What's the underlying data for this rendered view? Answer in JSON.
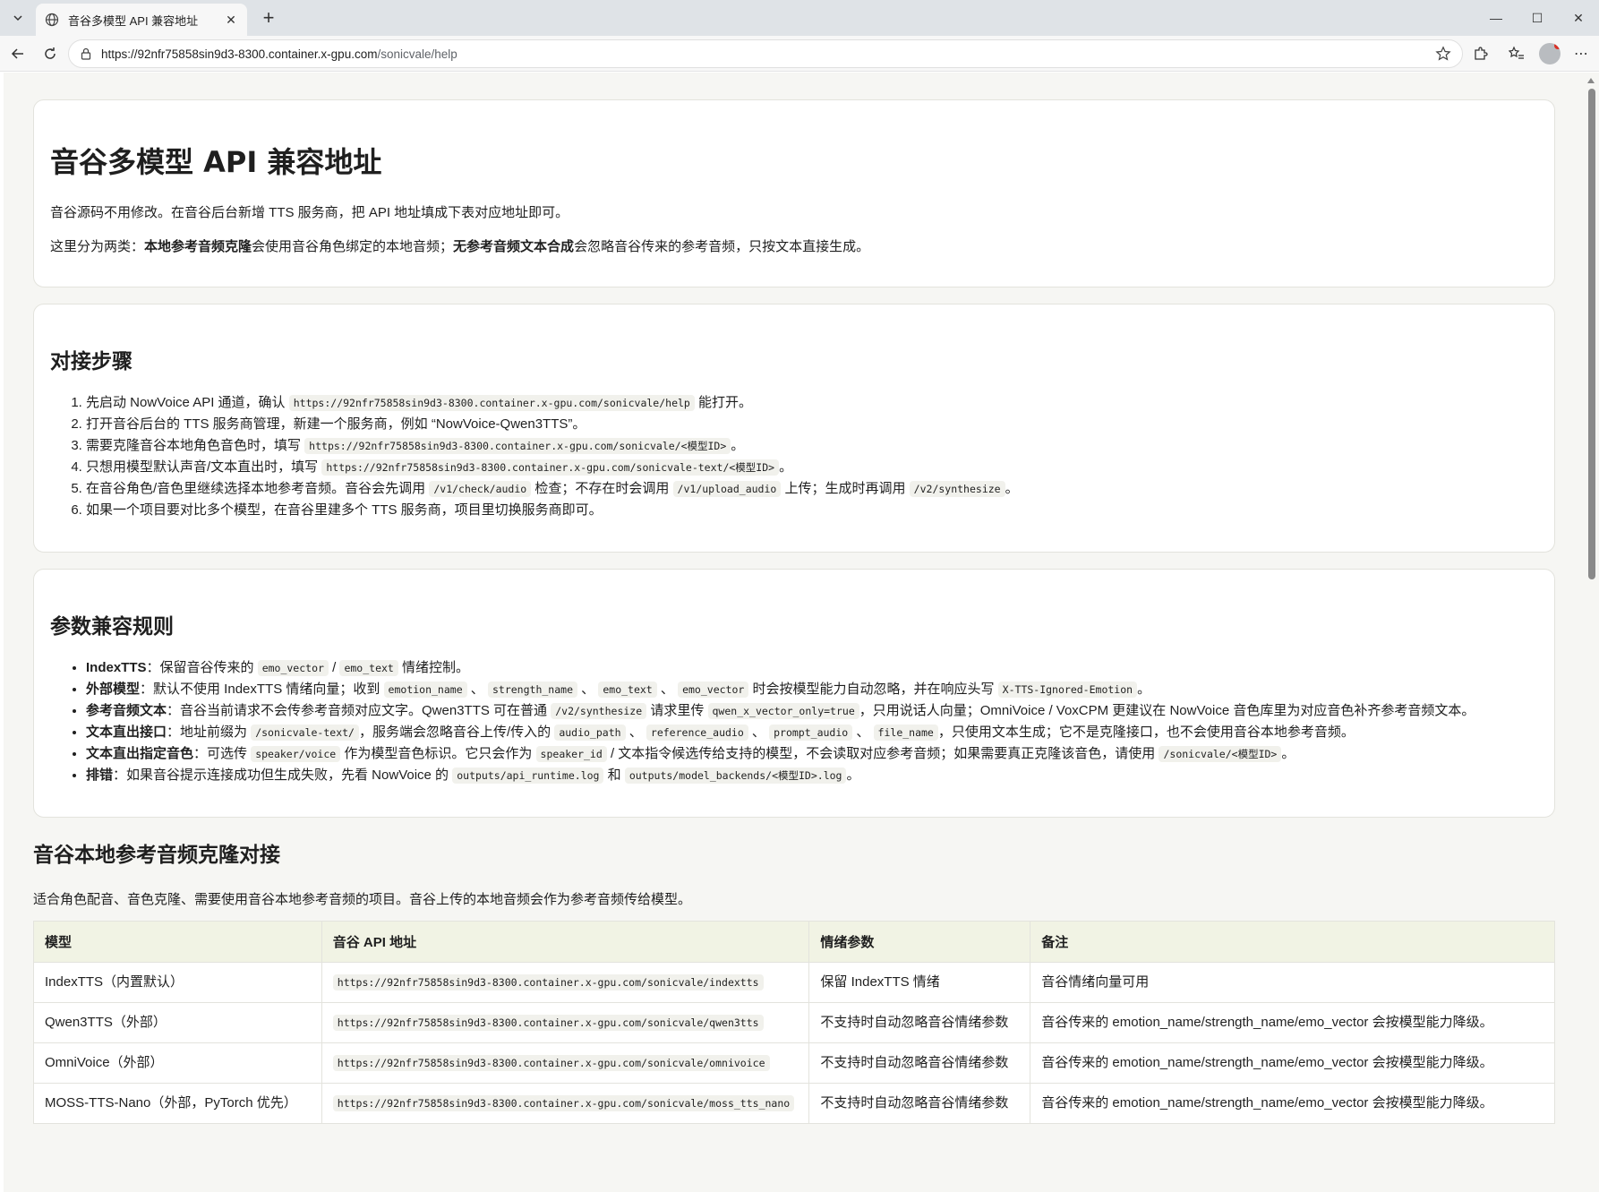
{
  "browser": {
    "tab_title": "音谷多模型 API 兼容地址",
    "url_host": "https://92nfr75858sin9d3-8300.container.x-gpu.com",
    "url_path": "/sonicvale/help"
  },
  "header": {
    "title": "音谷多模型 API 兼容地址",
    "intro": "音谷源码不用修改。在音谷后台新增 TTS 服务商，把 API 地址填成下表对应地址即可。",
    "split_prefix": "这里分为两类：",
    "split_bold1": "本地参考音频克隆",
    "split_mid": "会使用音谷角色绑定的本地音频；",
    "split_bold2": "无参考音频文本合成",
    "split_suffix": "会忽略音谷传来的参考音频，只按文本直接生成。"
  },
  "steps": {
    "title": "对接步骤",
    "s1_a": "先启动 NowVoice API 通道，确认 ",
    "s1_code": "https://92nfr75858sin9d3-8300.container.x-gpu.com/sonicvale/help",
    "s1_b": " 能打开。",
    "s2": "打开音谷后台的 TTS 服务商管理，新建一个服务商，例如 “NowVoice-Qwen3TTS”。",
    "s3_a": "需要克隆音谷本地角色音色时，填写 ",
    "s3_code": "https://92nfr75858sin9d3-8300.container.x-gpu.com/sonicvale/<模型ID>",
    "s3_b": "。",
    "s4_a": "只想用模型默认声音/文本直出时，填写 ",
    "s4_code": "https://92nfr75858sin9d3-8300.container.x-gpu.com/sonicvale-text/<模型ID>",
    "s4_b": "。",
    "s5_a": "在音谷角色/音色里继续选择本地参考音频。音谷会先调用 ",
    "s5_code1": "/v1/check/audio",
    "s5_b": " 检查；不存在时会调用 ",
    "s5_code2": "/v1/upload_audio",
    "s5_c": " 上传；生成时再调用 ",
    "s5_code3": "/v2/synthesize",
    "s5_d": "。",
    "s6": "如果一个项目要对比多个模型，在音谷里建多个 TTS 服务商，项目里切换服务商即可。"
  },
  "rules": {
    "title": "参数兼容规则",
    "r1_label": "IndexTTS",
    "r1_a": "：保留音谷传来的 ",
    "r1_code1": "emo_vector",
    "r1_b": " / ",
    "r1_code2": "emo_text",
    "r1_c": " 情绪控制。",
    "r2_label": "外部模型",
    "r2_a": "：默认不使用 IndexTTS 情绪向量；收到 ",
    "r2_code1": "emotion_name",
    "r2_sep1": " 、 ",
    "r2_code2": "strength_name",
    "r2_sep2": " 、 ",
    "r2_code3": "emo_text",
    "r2_sep3": " 、 ",
    "r2_code4": "emo_vector",
    "r2_b": " 时会按模型能力自动忽略，并在响应头写 ",
    "r2_code5": "X-TTS-Ignored-Emotion",
    "r2_c": "。",
    "r3_label": "参考音频文本",
    "r3_a": "：音谷当前请求不会传参考音频对应文字。Qwen3TTS 可在普通 ",
    "r3_code1": "/v2/synthesize",
    "r3_b": " 请求里传 ",
    "r3_code2": "qwen_x_vector_only=true",
    "r3_c": "，只用说话人向量；OmniVoice / VoxCPM 更建议在 NowVoice 音色库里为对应音色补齐参考音频文本。",
    "r4_label": "文本直出接口",
    "r4_a": "：地址前缀为 ",
    "r4_code1": "/sonicvale-text/",
    "r4_b": "，服务端会忽略音谷上传/传入的 ",
    "r4_code2": "audio_path",
    "r4_sep1": " 、 ",
    "r4_code3": "reference_audio",
    "r4_sep2": " 、 ",
    "r4_code4": "prompt_audio",
    "r4_sep3": " 、 ",
    "r4_code5": "file_name",
    "r4_c": "，只使用文本生成；它不是克隆接口，也不会使用音谷本地参考音频。",
    "r5_label": "文本直出指定音色",
    "r5_a": "：可选传 ",
    "r5_code1": "speaker/voice",
    "r5_b": " 作为模型音色标识。它只会作为 ",
    "r5_code2": "speaker_id",
    "r5_c": " / 文本指令候选传给支持的模型，不会读取对应参考音频；如果需要真正克隆该音色，请使用 ",
    "r5_code3": "/sonicvale/<模型ID>",
    "r5_d": "。",
    "r6_label": "排错",
    "r6_a": "：如果音谷提示连接成功但生成失败，先看 NowVoice 的 ",
    "r6_code1": "outputs/api_runtime.log",
    "r6_b": " 和 ",
    "r6_code2": "outputs/model_backends/<模型ID>.log",
    "r6_c": "。"
  },
  "local_clone": {
    "title": "音谷本地参考音频克隆对接",
    "desc": "适合角色配音、音色克隆、需要使用音谷本地参考音频的项目。音谷上传的本地音频会作为参考音频传给模型。",
    "columns": [
      "模型",
      "音谷 API 地址",
      "情绪参数",
      "备注"
    ],
    "rows": [
      {
        "model": "IndexTTS（内置默认）",
        "url": "https://92nfr75858sin9d3-8300.container.x-gpu.com/sonicvale/indextts",
        "emotion": "保留 IndexTTS 情绪",
        "note": "音谷情绪向量可用"
      },
      {
        "model": "Qwen3TTS（外部）",
        "url": "https://92nfr75858sin9d3-8300.container.x-gpu.com/sonicvale/qwen3tts",
        "emotion": "不支持时自动忽略音谷情绪参数",
        "note": "音谷传来的 emotion_name/strength_name/emo_vector 会按模型能力降级。"
      },
      {
        "model": "OmniVoice（外部）",
        "url": "https://92nfr75858sin9d3-8300.container.x-gpu.com/sonicvale/omnivoice",
        "emotion": "不支持时自动忽略音谷情绪参数",
        "note": "音谷传来的 emotion_name/strength_name/emo_vector 会按模型能力降级。"
      },
      {
        "model": "MOSS-TTS-Nano（外部，PyTorch 优先）",
        "url": "https://92nfr75858sin9d3-8300.container.x-gpu.com/sonicvale/moss_tts_nano",
        "emotion": "不支持时自动忽略音谷情绪参数",
        "note": "音谷传来的 emotion_name/strength_name/emo_vector 会按模型能力降级。"
      }
    ]
  }
}
